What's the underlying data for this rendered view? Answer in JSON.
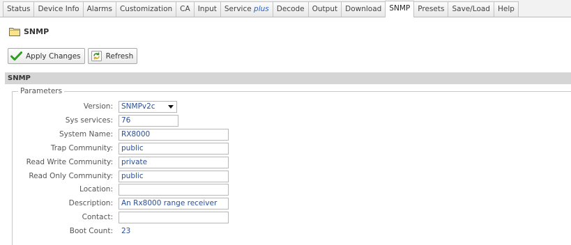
{
  "tabs": [
    {
      "label": "Status",
      "suffix": ""
    },
    {
      "label": "Device Info",
      "suffix": ""
    },
    {
      "label": "Alarms",
      "suffix": ""
    },
    {
      "label": "Customization",
      "suffix": ""
    },
    {
      "label": "CA",
      "suffix": ""
    },
    {
      "label": "Input",
      "suffix": ""
    },
    {
      "label": "Service ",
      "suffix": "plus"
    },
    {
      "label": "Decode",
      "suffix": ""
    },
    {
      "label": "Output",
      "suffix": ""
    },
    {
      "label": "Download",
      "suffix": ""
    },
    {
      "label": "SNMP",
      "suffix": ""
    },
    {
      "label": "Presets",
      "suffix": ""
    },
    {
      "label": "Save/Load",
      "suffix": ""
    },
    {
      "label": "Help",
      "suffix": ""
    }
  ],
  "active_tab": "SNMP",
  "page": {
    "title": "SNMP",
    "icon": "folder-icon"
  },
  "toolbar": {
    "apply_label": "Apply Changes",
    "refresh_label": "Refresh"
  },
  "section": {
    "title": "SNMP",
    "fieldset_legend": "Parameters"
  },
  "form": {
    "version": {
      "label": "Version:",
      "value": "SNMPv2c"
    },
    "sys_services": {
      "label": "Sys services:",
      "value": "76"
    },
    "system_name": {
      "label": "System Name:",
      "value": "RX8000"
    },
    "trap_community": {
      "label": "Trap Community:",
      "value": "public"
    },
    "read_write_community": {
      "label": "Read Write Community:",
      "value": "private"
    },
    "read_only_community": {
      "label": "Read Only Community:",
      "value": "public"
    },
    "location": {
      "label": "Location:",
      "value": ""
    },
    "description": {
      "label": "Description:",
      "value": "An Rx8000 range receiver"
    },
    "contact": {
      "label": "Contact:",
      "value": ""
    },
    "boot_count": {
      "label": "Boot Count:",
      "value": "23"
    }
  },
  "colors": {
    "accent_text": "#2a4f9a",
    "apply_icon": "#2e9e1f",
    "refresh_icon": "#3a8f2a",
    "section_bar": "#d5d5d5"
  }
}
